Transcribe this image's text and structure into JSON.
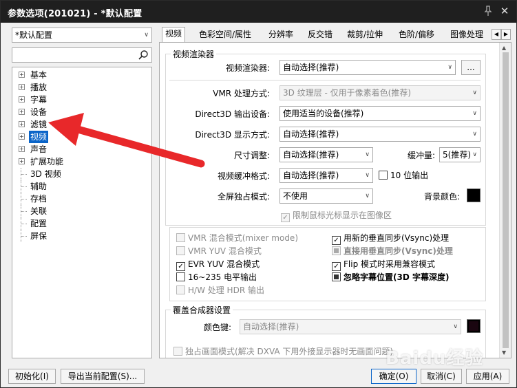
{
  "window": {
    "title": "参数选项(201021) - *默认配置"
  },
  "left": {
    "profile": "*默认配置",
    "search_placeholder": "",
    "tree": [
      {
        "label": "基本",
        "expandable": true
      },
      {
        "label": "播放",
        "expandable": true
      },
      {
        "label": "字幕",
        "expandable": true
      },
      {
        "label": "设备",
        "expandable": true
      },
      {
        "label": "滤镜",
        "expandable": true
      },
      {
        "label": "视频",
        "expandable": true,
        "selected": true
      },
      {
        "label": "声音",
        "expandable": true
      },
      {
        "label": "扩展功能",
        "expandable": true
      },
      {
        "label": "3D 视频",
        "expandable": false
      },
      {
        "label": "辅助",
        "expandable": false
      },
      {
        "label": "存档",
        "expandable": false
      },
      {
        "label": "关联",
        "expandable": false
      },
      {
        "label": "配置",
        "expandable": false
      },
      {
        "label": "屏保",
        "expandable": false
      }
    ]
  },
  "tabs": [
    "视频",
    "色彩空间/属性",
    "分辨率",
    "反交错",
    "裁剪/拉伸",
    "色阶/偏移",
    "图像处理"
  ],
  "renderer_group": {
    "title": "视频渲染器",
    "renderer_label": "视频渲染器:",
    "renderer_value": "自动选择(推荐)",
    "more_button": "...",
    "vmr_mode_label": "VMR 处理方式:",
    "vmr_mode_value": "3D 纹理层 - 仅用于像素着色(推荐)",
    "d3d_device_label": "Direct3D 输出设备:",
    "d3d_device_value": "使用适当的设备(推荐)",
    "d3d_display_label": "Direct3D 显示方式:",
    "d3d_display_value": "自动选择(推荐)",
    "resize_label": "尺寸调整:",
    "resize_value": "自动选择(推荐)",
    "buffer_label": "缓冲量:",
    "buffer_value": "5(推荐)",
    "buffer_format_label": "视频缓冲格式:",
    "buffer_format_value": "自动选择(推荐)",
    "tenbit_label": "10 位输出",
    "fullscreen_label": "全屏独占模式:",
    "fullscreen_value": "不使用",
    "bg_color_label": "背景颜色:",
    "limit_cursor_label": "限制鼠标光标显示在图像区"
  },
  "checks": {
    "vmr_mix": "VMR 混合模式(mixer mode)",
    "vmr_yuv": "VMR YUV 混合模式",
    "evr_yuv": "EVR YUV 混合模式",
    "range_16_235": "16~235 电平输出",
    "hw_hdr": "H/W 处理 HDR 输出",
    "new_vsync": "用新的垂直同步(Vsync)处理",
    "direct_vsync": "直接用垂直同步(Vsync)处理",
    "flip_compat": "Flip 模式时采用兼容模式",
    "ignore_sub_pos": "忽略字幕位置(3D 字幕深度)"
  },
  "overlay_group": {
    "title": "覆盖合成器设置",
    "color_key_label": "颜色键:",
    "color_key_value": "自动选择(推荐)",
    "exclusive_label": "独占画面模式(解决 DXVA 下用外接显示器时无画面问题)"
  },
  "buttons": {
    "init": "初始化(I)",
    "export": "导出当前配置(S)...",
    "ok": "确定(O)",
    "cancel": "取消(C)",
    "apply": "应用(A)"
  },
  "colors": {
    "accent": "#0a64c8",
    "annotation_arrow": "#e8282a",
    "background_color": "#000000"
  },
  "watermark": "Baidu经验"
}
